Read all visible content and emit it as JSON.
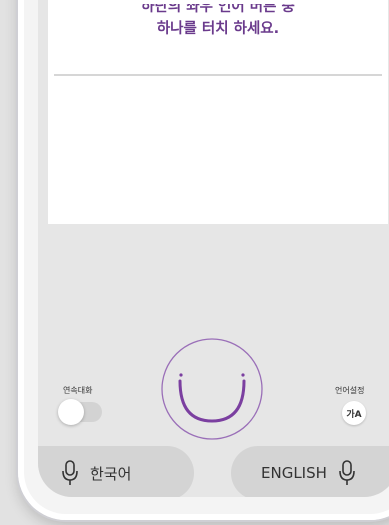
{
  "instruction": {
    "line1": "하단의 좌우 언어 버튼 중",
    "line2": "하나를 터치 하세요."
  },
  "continuous_chat": {
    "label": "연속대화",
    "enabled": false
  },
  "language_settings": {
    "label": "언어설정",
    "icon_text": "가A",
    "icon": "language-icon"
  },
  "mic_button": {
    "icon": "smile-face-icon",
    "accent": "#7b3fa0"
  },
  "lang_buttons": {
    "left": {
      "label": "한국어",
      "icon": "microphone-icon"
    },
    "right": {
      "label": "ENGLISH",
      "icon": "microphone-icon"
    }
  },
  "colors": {
    "accent": "#6a3a8c",
    "button_bg": "#d4d4d4",
    "panel_bg": "#ffffff"
  }
}
